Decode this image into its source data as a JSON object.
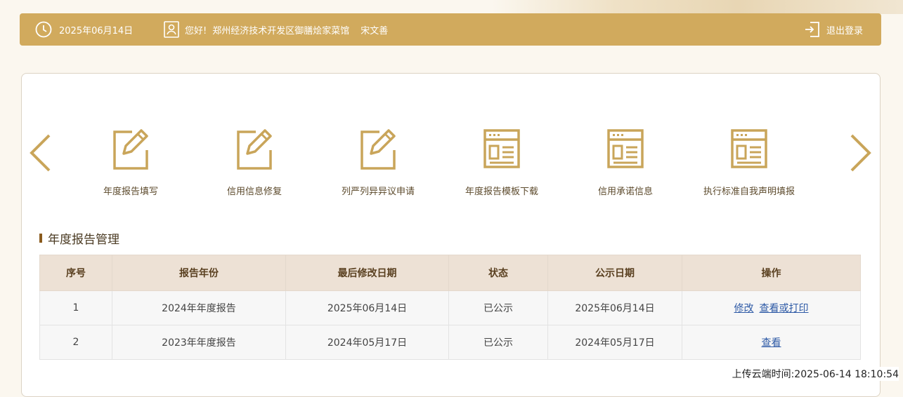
{
  "header": {
    "date": "2025年06月14日",
    "greeting": "您好!",
    "company": "郑州经济技术开发区御膳烩家菜馆",
    "user_name": "宋文善",
    "logout_label": "退出登录"
  },
  "menu": [
    {
      "label": "年度报告填写",
      "icon": "edit-icon"
    },
    {
      "label": "信用信息修复",
      "icon": "edit-icon"
    },
    {
      "label": "列严列异异议申请",
      "icon": "edit-icon"
    },
    {
      "label": "年度报告模板下载",
      "icon": "document-icon"
    },
    {
      "label": "信用承诺信息",
      "icon": "document-icon"
    },
    {
      "label": "执行标准自我声明填报",
      "icon": "document-icon"
    }
  ],
  "section_title": "年度报告管理",
  "table": {
    "headers": [
      "序号",
      "报告年份",
      "最后修改日期",
      "状态",
      "公示日期",
      "操作"
    ],
    "rows": [
      {
        "index": "1",
        "year": "2024年年度报告",
        "modified": "2025年06月14日",
        "status": "已公示",
        "published": "2025年06月14日",
        "actions": [
          "修改",
          "查看或打印"
        ]
      },
      {
        "index": "2",
        "year": "2023年年度报告",
        "modified": "2024年05月17日",
        "status": "已公示",
        "published": "2024年05月17日",
        "actions": [
          "查看"
        ]
      }
    ]
  },
  "upload_time": "上传云端时间:2025-06-14 18:10:54",
  "colors": {
    "accent": "#d1aa5d",
    "icon": "#c9a55a",
    "link": "#2e5aa6"
  }
}
